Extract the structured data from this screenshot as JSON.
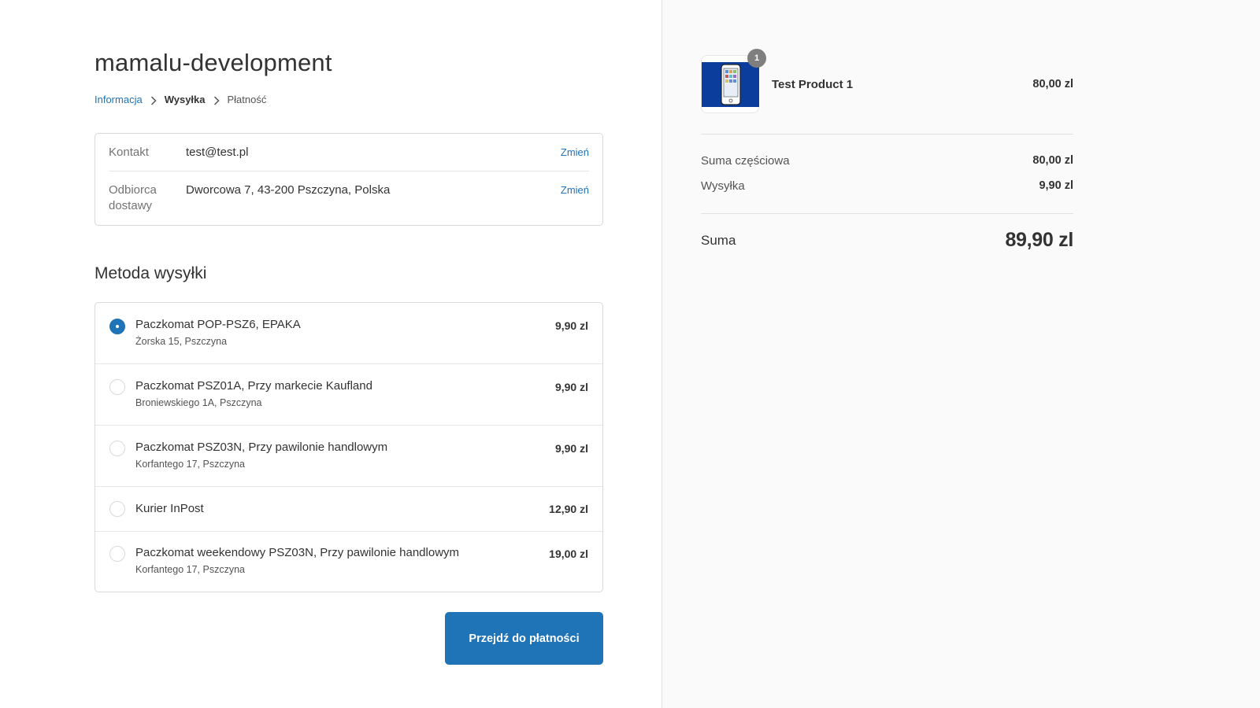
{
  "store": {
    "title": "mamalu-development"
  },
  "breadcrumb": {
    "step1": "Informacja",
    "step2": "Wysyłka",
    "step3": "Płatność"
  },
  "review": {
    "contact_label": "Kontakt",
    "contact_value": "test@test.pl",
    "contact_change": "Zmień",
    "ship_label": "Odbiorca dostawy",
    "ship_value": "Dworcowa 7, 43-200 Pszczyna, Polska",
    "ship_change": "Zmień"
  },
  "shipping": {
    "title": "Metoda wysyłki",
    "methods": [
      {
        "name": "Paczkomat POP-PSZ6, EPAKA",
        "address": "Żorska 15, Pszczyna",
        "price": "9,90 zl",
        "selected": true
      },
      {
        "name": "Paczkomat PSZ01A, Przy markecie Kaufland",
        "address": "Broniewskiego 1A, Pszczyna",
        "price": "9,90 zl",
        "selected": false
      },
      {
        "name": "Paczkomat PSZ03N, Przy pawilonie handlowym",
        "address": "Korfantego 17, Pszczyna",
        "price": "9,90 zl",
        "selected": false
      },
      {
        "name": "Kurier InPost",
        "address": "",
        "price": "12,90 zl",
        "selected": false
      },
      {
        "name": "Paczkomat weekendowy PSZ03N, Przy pawilonie handlowym",
        "address": "Korfantego 17, Pszczyna",
        "price": "19,00 zl",
        "selected": false
      }
    ]
  },
  "actions": {
    "continue_label": "Przejdź do płatności"
  },
  "summary": {
    "product": {
      "name": "Test Product 1",
      "price": "80,00 zl",
      "quantity": "1",
      "image_icon": "smartphone-icon"
    },
    "subtotal_label": "Suma częściowa",
    "subtotal_value": "80,00 zl",
    "shipping_label": "Wysyłka",
    "shipping_value": "9,90 zl",
    "total_label": "Suma",
    "total_value": "89,90 zl"
  },
  "colors": {
    "accent": "#1f73b7",
    "sidebar_bg": "#fafafa",
    "thumb_bg": "#0b3d9c"
  }
}
